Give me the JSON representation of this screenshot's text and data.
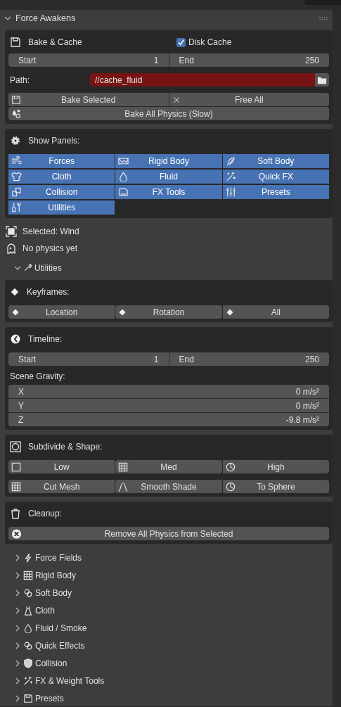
{
  "panel": {
    "title": "Force Awakens",
    "expanded": true
  },
  "bake": {
    "title": "Bake & Cache",
    "disk_cache": {
      "label": "Disk Cache",
      "checked": true
    },
    "range": [
      {
        "label": "Start",
        "value": "1"
      },
      {
        "label": "End",
        "value": "250"
      }
    ],
    "path": {
      "label": "Path:",
      "value": "//cache_fluid"
    },
    "buttons": [
      "Bake Selected",
      "Free All"
    ],
    "bake_all": "Bake All Physics (Slow)"
  },
  "show_panels": {
    "title": "Show Panels:",
    "toggles": [
      {
        "label": "Forces",
        "selected": true
      },
      {
        "label": "Rigid Body",
        "selected": true
      },
      {
        "label": "Soft Body",
        "selected": true
      },
      {
        "label": "Cloth",
        "selected": true
      },
      {
        "label": "Fluid",
        "selected": true
      },
      {
        "label": "Quick FX",
        "selected": true
      },
      {
        "label": "Collision",
        "selected": true
      },
      {
        "label": "FX Tools",
        "selected": true
      },
      {
        "label": "Presets",
        "selected": true
      },
      {
        "label": "Utilities",
        "selected": true
      }
    ]
  },
  "selected_label": "Selected: Wind",
  "status": "No physics yet",
  "utilities": {
    "label": "Utilities",
    "expanded": true
  },
  "keyframes": {
    "title": "Keyframes:",
    "buttons": [
      "Location",
      "Rotation",
      "All"
    ]
  },
  "timeline": {
    "title": "Timeline:",
    "range": [
      {
        "label": "Start",
        "value": "1"
      },
      {
        "label": "End",
        "value": "250"
      }
    ],
    "gravity_label": "Scene Gravity:",
    "gravity": [
      {
        "axis": "X",
        "value": "0 m/s²"
      },
      {
        "axis": "Y",
        "value": "0 m/s²"
      },
      {
        "axis": "Z",
        "value": "-9.8 m/s²"
      }
    ]
  },
  "subdivide": {
    "title": "Subdivide & Shape:",
    "rows": [
      [
        "Low",
        "Med",
        "High"
      ],
      [
        "Cut Mesh",
        "Smooth Shade",
        "To Sphere"
      ]
    ]
  },
  "cleanup": {
    "title": "Cleanup:",
    "button": "Remove All Physics from Selected"
  },
  "subpanels": [
    {
      "label": "Force Fields",
      "expanded": false
    },
    {
      "label": "Rigid Body",
      "expanded": false
    },
    {
      "label": "Soft Body",
      "expanded": false
    },
    {
      "label": "Cloth",
      "expanded": false
    },
    {
      "label": "Fluid / Smoke",
      "expanded": false
    },
    {
      "label": "Quick Effects",
      "expanded": false
    },
    {
      "label": "Collision",
      "expanded": false
    },
    {
      "label": "FX & Weight Tools",
      "expanded": false
    },
    {
      "label": "Presets",
      "expanded": false
    }
  ]
}
